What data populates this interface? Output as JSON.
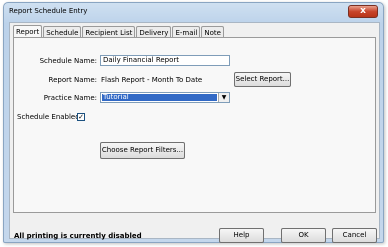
{
  "window": {
    "title": "Report Schedule Entry",
    "close_label": "x"
  },
  "tabs": [
    "Report",
    "Schedule",
    "Recipient List",
    "Delivery",
    "E-mail",
    "Note"
  ],
  "form": {
    "schedule_name_label": "Schedule Name:",
    "schedule_name_value": "Daily Financial Report",
    "report_name_label": "Report Name:",
    "report_name_value": "Flash Report - Month To Date",
    "select_report_button": "Select Report...",
    "practice_name_label": "Practice Name:",
    "practice_name_value": "Tutorial",
    "schedule_enabled_label": "Schedule Enabled",
    "schedule_enabled_checked": true,
    "choose_filters_button": "Choose Report Filters..."
  },
  "footer": {
    "status": "All printing is currently disabled",
    "help_button": "Help",
    "ok_button": "OK",
    "cancel_button": "Cancel"
  }
}
